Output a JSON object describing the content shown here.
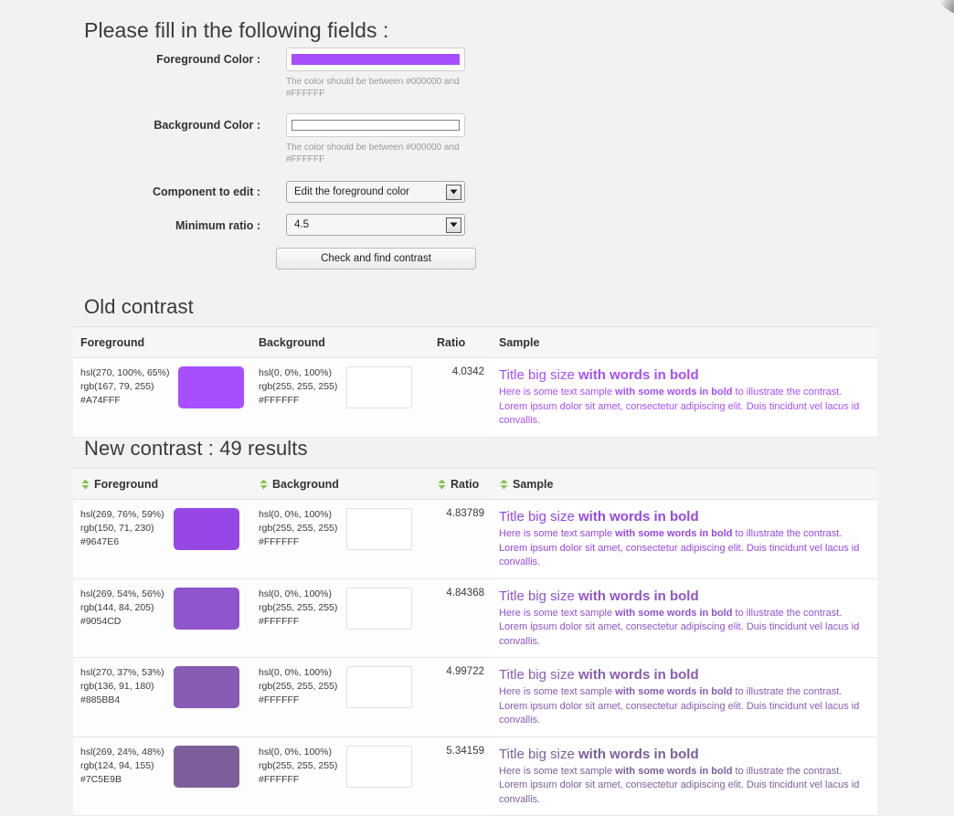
{
  "form": {
    "title": "Please fill in the following fields :",
    "fields": [
      {
        "label": "Foreground Color :",
        "type": "color",
        "value": "#A74FFF",
        "help": "The color should be between #000000 and #FFFFFF"
      },
      {
        "label": "Background Color :",
        "type": "color",
        "value": "#FFFFFF",
        "help": "The color should be between #000000 and #FFFFFF"
      },
      {
        "label": "Component to edit :",
        "type": "select",
        "value": "Edit the foreground color"
      },
      {
        "label": "Minimum ratio :",
        "type": "select",
        "value": "4.5"
      }
    ],
    "submit_label": "Check and find contrast"
  },
  "old_contrast": {
    "title": "Old contrast",
    "columns": [
      "Foreground",
      "Background",
      "Ratio",
      "Sample"
    ],
    "rows": [
      {
        "fg_hsl": "hsl(270, 100%, 65%)",
        "fg_rgb": "rgb(167, 79, 255)",
        "fg_hex": "#A74FFF",
        "bg_hsl": "hsl(0, 0%, 100%)",
        "bg_rgb": "rgb(255, 255, 255)",
        "bg_hex": "#FFFFFF",
        "ratio": "4.0342",
        "sample_title_plain": "Title big size ",
        "sample_title_bold": "with words in bold",
        "sample_body_1": "Here is some text sample ",
        "sample_body_bold": "with some words in bold",
        "sample_body_2": " to illustrate the contrast. Lorem ipsum dolor sit amet, consectetur adipiscing elit. Duis tincidunt vel lacus id convallis."
      }
    ]
  },
  "new_contrast": {
    "title": "New contrast : 49 results",
    "result_count": 49,
    "columns": [
      "Foreground",
      "Background",
      "Ratio",
      "Sample"
    ],
    "sort_icon": "sort-arrows-icon",
    "sort_icon_color": "#7cb342",
    "rows": [
      {
        "fg_hsl": "hsl(269, 76%, 59%)",
        "fg_rgb": "rgb(150, 71, 230)",
        "fg_hex": "#9647E6",
        "bg_hsl": "hsl(0, 0%, 100%)",
        "bg_rgb": "rgb(255, 255, 255)",
        "bg_hex": "#FFFFFF",
        "ratio": "4.83789",
        "sample_title_plain": "Title big size ",
        "sample_title_bold": "with words in bold",
        "sample_body_1": "Here is some text sample ",
        "sample_body_bold": "with some words in bold",
        "sample_body_2": " to illustrate the contrast. Lorem ipsum dolor sit amet, consectetur adipiscing elit. Duis tincidunt vel lacus id convallis."
      },
      {
        "fg_hsl": "hsl(269, 54%, 56%)",
        "fg_rgb": "rgb(144, 84, 205)",
        "fg_hex": "#9054CD",
        "bg_hsl": "hsl(0, 0%, 100%)",
        "bg_rgb": "rgb(255, 255, 255)",
        "bg_hex": "#FFFFFF",
        "ratio": "4.84368",
        "sample_title_plain": "Title big size ",
        "sample_title_bold": "with words in bold",
        "sample_body_1": "Here is some text sample ",
        "sample_body_bold": "with some words in bold",
        "sample_body_2": " to illustrate the contrast. Lorem ipsum dolor sit amet, consectetur adipiscing elit. Duis tincidunt vel lacus id convallis."
      },
      {
        "fg_hsl": "hsl(270, 37%, 53%)",
        "fg_rgb": "rgb(136, 91, 180)",
        "fg_hex": "#885BB4",
        "bg_hsl": "hsl(0, 0%, 100%)",
        "bg_rgb": "rgb(255, 255, 255)",
        "bg_hex": "#FFFFFF",
        "ratio": "4.99722",
        "sample_title_plain": "Title big size ",
        "sample_title_bold": "with words in bold",
        "sample_body_1": "Here is some text sample ",
        "sample_body_bold": "with some words in bold",
        "sample_body_2": " to illustrate the contrast. Lorem ipsum dolor sit amet, consectetur adipiscing elit. Duis tincidunt vel lacus id convallis."
      },
      {
        "fg_hsl": "hsl(269, 24%, 48%)",
        "fg_rgb": "rgb(124, 94, 155)",
        "fg_hex": "#7C5E9B",
        "bg_hsl": "hsl(0, 0%, 100%)",
        "bg_rgb": "rgb(255, 255, 255)",
        "bg_hex": "#FFFFFF",
        "ratio": "5.34159",
        "sample_title_plain": "Title big size ",
        "sample_title_bold": "with words in bold",
        "sample_body_1": "Here is some text sample ",
        "sample_body_bold": "with some words in bold",
        "sample_body_2": " to illustrate the contrast. Lorem ipsum dolor sit amet, consectetur adipiscing elit. Duis tincidunt vel lacus id convallis."
      }
    ]
  }
}
